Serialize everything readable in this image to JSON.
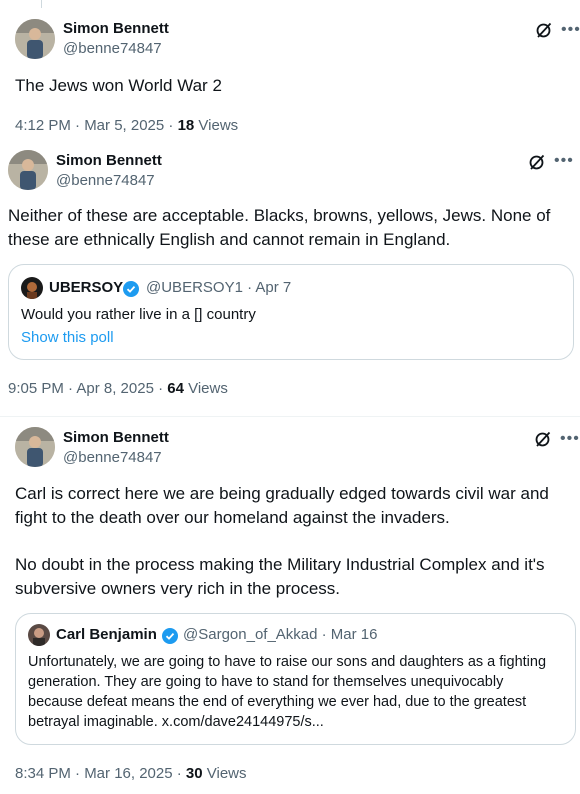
{
  "posts": [
    {
      "author": {
        "name": "Simon Bennett",
        "handle": "@benne74847"
      },
      "text": "The Jews won World War 2",
      "time": "4:12 PM · Mar 5, 2025 · ",
      "views_count": "18",
      "views_label": " Views"
    },
    {
      "author": {
        "name": "Simon Bennett",
        "handle": "@benne74847"
      },
      "text": "Neither of these are acceptable. Blacks, browns, yellows, Jews. None of these are ethnically English and cannot remain in England.",
      "quote": {
        "name": "UBERSOY",
        "handle_date": "@UBERSOY1 · Apr 7",
        "text": "Would you rather live in a [] country",
        "link": "Show this poll"
      },
      "time": "9:05 PM · Apr 8, 2025 · ",
      "views_count": "64",
      "views_label": " Views"
    },
    {
      "author": {
        "name": "Simon Bennett",
        "handle": "@benne74847"
      },
      "text_p1": "Carl is correct here we are being gradually edged towards civil war and fight to the death over our homeland against the invaders.",
      "text_p2": "No doubt in the process making the Military Industrial Complex and it's subversive owners very rich in the process.",
      "quote": {
        "name": "Carl Benjamin",
        "handle_date": "@Sargon_of_Akkad · Mar 16",
        "text": "Unfortunately, we are going to have to raise our sons and daughters as a fighting generation. They are going to have to stand for themselves unequivocably because defeat means the end of everything we ever had, due to the greatest betrayal imaginable. x.com/dave24144975/s..."
      },
      "time": "8:34 PM · Mar 16, 2025 · ",
      "views_count": "30",
      "views_label": " Views"
    }
  ],
  "icons": {
    "grok": "grok-icon",
    "more": "more-icon",
    "verified": "verified-badge-icon"
  },
  "colors": {
    "link": "#1d9bf0",
    "secondary": "#536471",
    "border": "#cfd9de"
  }
}
